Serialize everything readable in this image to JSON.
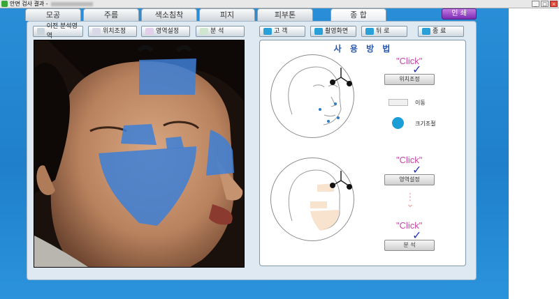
{
  "window": {
    "title": "안면 검사 결과 -",
    "controls": [
      "_",
      "□",
      "×"
    ]
  },
  "tabs": [
    {
      "label": "모공"
    },
    {
      "label": "주름"
    },
    {
      "label": "색소침착"
    },
    {
      "label": "피지"
    },
    {
      "label": "피부톤"
    },
    {
      "label": "종  합"
    }
  ],
  "print_label": "인 쇄",
  "toolbar": {
    "prev_area": "이전 분석영역",
    "position": "위치조정",
    "area": "영역설정",
    "analyze": "분   석",
    "customer": "고  객",
    "capture": "촬영화면",
    "back": "뒤  로",
    "exit": "종  료"
  },
  "guide": {
    "title": "사 용 방 법",
    "click": "\"Click\"",
    "move": "이동",
    "resize": "크기조절",
    "btn_position": "위치조정",
    "btn_area": "영역설정",
    "btn_analyze": "분   석"
  },
  "colors": {
    "mask": "#3d7fd6",
    "accent": "#2a58a8",
    "click": "#c445a6",
    "resize_dot": "#1b9dd6"
  }
}
